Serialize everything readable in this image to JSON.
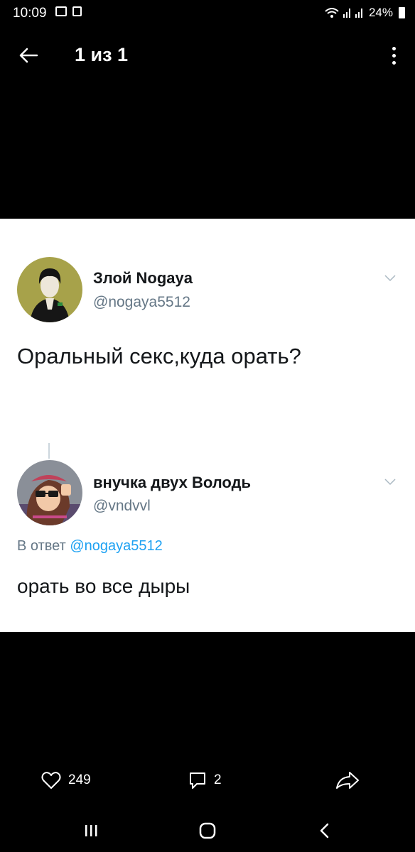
{
  "status_bar": {
    "time": "10:09",
    "battery": "24%"
  },
  "app_bar": {
    "counter": "1 из 1"
  },
  "tweet": {
    "display_name": "Злой Nogaya",
    "handle": "@nogaya5512",
    "text": "Оральный секс,куда орать?"
  },
  "reply": {
    "display_name": "внучка двух Володь",
    "handle": "@vndvvl",
    "reply_prefix": "В ответ",
    "reply_to": "@nogaya5512",
    "text": "орать во все дыры"
  },
  "actions": {
    "likes": "249",
    "replies": "2"
  },
  "icons": [
    "back-arrow-icon",
    "more-vert-icon",
    "chevron-down-icon",
    "heart-icon",
    "comment-icon",
    "share-icon",
    "recents-icon",
    "home-icon",
    "nav-back-icon",
    "gallery-icon",
    "wifi-icon",
    "signal-icon",
    "battery-icon"
  ]
}
